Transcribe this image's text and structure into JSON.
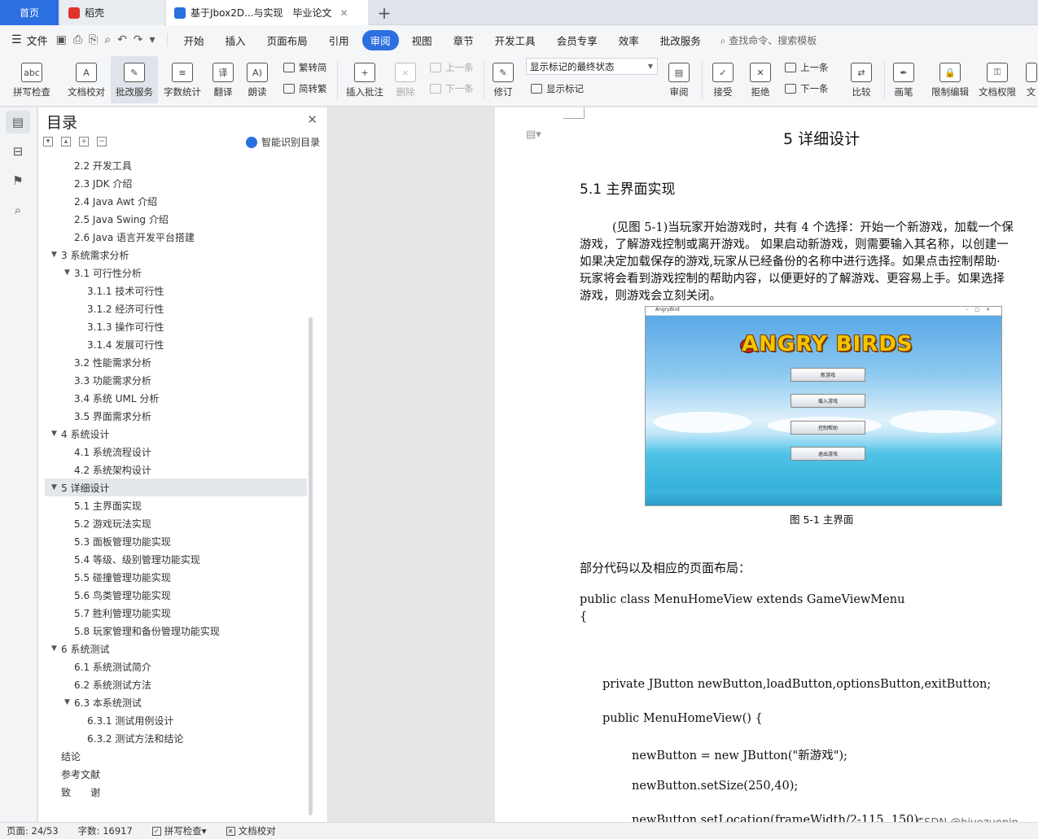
{
  "tabs": {
    "home": "首页",
    "daoke": "稻壳",
    "document": "基于Jbox2D...与实现　毕业论文"
  },
  "menu": {
    "file": "文件",
    "items": [
      "开始",
      "插入",
      "页面布局",
      "引用",
      "审阅",
      "视图",
      "章节",
      "开发工具",
      "会员专享",
      "效率",
      "批改服务"
    ],
    "active": "审阅",
    "search": "查找命令、搜索模板"
  },
  "ribbon": {
    "spell": "拼写检查",
    "proof": "文档校对",
    "correct": "批改服务",
    "wordcount": "字数统计",
    "translate": "翻译",
    "read": "朗读",
    "t2s": "繁转简",
    "s2t": "简转繁",
    "insert_comment": "插入批注",
    "delete": "删除",
    "prev_disabled": "上一条",
    "next_disabled": "下一条",
    "revise": "修订",
    "markup_state": "显示标记的最终状态",
    "show_markup": "显示标记",
    "review": "审阅",
    "accept": "接受",
    "reject": "拒绝",
    "prev": "上一条",
    "next": "下一条",
    "compare": "比较",
    "pen": "画笔",
    "restrict": "限制编辑",
    "perm": "文档权限",
    "more": "文"
  },
  "toc": {
    "title": "目录",
    "smart": "智能识别目录",
    "items": [
      {
        "label": "2.2  开发工具",
        "level": 2
      },
      {
        "label": "2.3 JDK 介绍",
        "level": 2
      },
      {
        "label": "2.4 Java Awt 介绍",
        "level": 2
      },
      {
        "label": "2.5 Java Swing  介绍",
        "level": 2
      },
      {
        "label": "2.6 Java 语言开发平台搭建",
        "level": 2
      },
      {
        "label": "3 系统需求分析",
        "level": 1
      },
      {
        "label": "3.1  可行性分析",
        "level": 2
      },
      {
        "label": "3.1.1  技术可行性",
        "level": 3
      },
      {
        "label": "3.1.2  经济可行性",
        "level": 3
      },
      {
        "label": "3.1.3  操作可行性",
        "level": 3
      },
      {
        "label": "3.1.4  发展可行性",
        "level": 3
      },
      {
        "label": "3.2  性能需求分析",
        "level": 2
      },
      {
        "label": "3.3  功能需求分析",
        "level": 2
      },
      {
        "label": "3.4  系统 UML 分析",
        "level": 2
      },
      {
        "label": "3.5 界面需求分析",
        "level": 2
      },
      {
        "label": "4  系统设计",
        "level": 1
      },
      {
        "label": "4.1 系统流程设计",
        "level": 2
      },
      {
        "label": "4.2  系统架构设计",
        "level": 2
      },
      {
        "label": "5  详细设计",
        "level": 1
      },
      {
        "label": "5.1  主界面实现",
        "level": 2
      },
      {
        "label": "5.2  游戏玩法实现",
        "level": 2
      },
      {
        "label": "5.3  面板管理功能实现",
        "level": 2
      },
      {
        "label": "5.4  等级、级别管理功能实现",
        "level": 2
      },
      {
        "label": "5.5  碰撞管理功能实现",
        "level": 2
      },
      {
        "label": "5.6  鸟类管理功能实现",
        "level": 2
      },
      {
        "label": "5.7  胜利管理功能实现",
        "level": 2
      },
      {
        "label": "5.8  玩家管理和备份管理功能实现",
        "level": 2
      },
      {
        "label": "6  系统测试",
        "level": 1
      },
      {
        "label": "6.1 系统测试简介",
        "level": 2
      },
      {
        "label": "6.2  系统测试方法",
        "level": 2
      },
      {
        "label": "6.3  本系统测试",
        "level": 2
      },
      {
        "label": "6.3.1  测试用例设计",
        "level": 3
      },
      {
        "label": "6.3.2  测试方法和结论",
        "level": 3
      },
      {
        "label": "结论",
        "level": 1
      },
      {
        "label": "参考文献",
        "level": 1
      },
      {
        "label": "致　　谢",
        "level": 1
      }
    ]
  },
  "doc": {
    "h1": "5  详细设计",
    "h2": "5.1  主界面实现",
    "para": [
      "(见图 5-1)当玩家开始游戏时，共有 4 个选择：开始一个新游戏，加载一个保",
      "游戏，了解游戏控制或离开游戏。 如果启动新游戏，则需要输入其名称，以创建一",
      "如果决定加载保存的游戏,玩家从已经备份的名称中进行选择。如果点击控制帮助·",
      "玩家将会看到游戏控制的帮助内容，以便更好的了解游戏、更容易上手。如果选择",
      "游戏，则游戏会立刻关闭。"
    ],
    "shot": {
      "window_title": "AngryBird",
      "logo": "ANGRY BIRDS",
      "buttons": [
        "新游戏",
        "载入游戏",
        "控制帮助",
        "退出游戏"
      ]
    },
    "caption": "图 5-1  主界面",
    "intro": "部分代码以及相应的页面布局：",
    "code": [
      "public class MenuHomeView extends GameViewMenu",
      "{",
      "private JButton newButton,loadButton,optionsButton,exitButton;",
      "public MenuHomeView() {",
      "newButton = new JButton(\"新游戏\");",
      "newButton.setSize(250,40);",
      "newButton.setLocation(frameWidth/2-115, 150);"
    ]
  },
  "status": {
    "page": "页面: 24/53",
    "words": "字数: 16917",
    "spell": "拼写检查",
    "proof": "文档校对"
  },
  "watermark": "CSDN @biyezuopin"
}
